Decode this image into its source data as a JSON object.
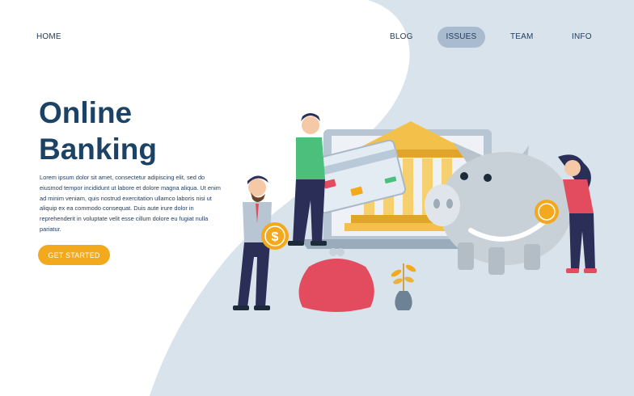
{
  "nav": {
    "items": [
      {
        "label": "HOME"
      },
      {
        "label": "BLOG"
      },
      {
        "label": "ISSUES",
        "active": true
      },
      {
        "label": "TEAM"
      },
      {
        "label": "INFO"
      }
    ]
  },
  "hero": {
    "title_line1": "Online",
    "title_line2": "Banking",
    "body": "Lorem ipsum dolor sit amet, consectetur adipiscing elit, sed do eiusmod tempor incididunt ut labore et dolore magna aliqua. Ut enim ad minim veniam, quis nostrud exercitation ullamco laboris nisi ut aliquip ex ea commodo consequat. Duis aute irure dolor in reprehenderit in voluptate velit esse cillum dolore eu fugiat nulla pariatur.",
    "cta_label": "GET STARTED"
  },
  "colors": {
    "accent": "#f2a91d",
    "title": "#1c4366",
    "backdrop": "#d9e3ec",
    "nav_active_bg": "#a9bccf"
  },
  "illustration": {
    "coin_symbol": "$"
  }
}
